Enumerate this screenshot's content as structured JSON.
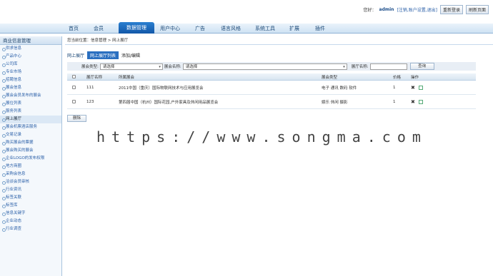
{
  "header": {
    "welcome": "您好：",
    "user": "admin",
    "links": "[注销,账户设置,退出]",
    "btn_home": "重新登录",
    "btn_refresh": "刷新页面"
  },
  "nav": {
    "items": [
      "首页",
      "会员",
      "",
      "用户中心",
      "广告",
      "语言风格",
      "系统工具",
      "扩展",
      "插件"
    ],
    "active": "数据管理"
  },
  "sidebar": {
    "title": "商业信息管理",
    "items": [
      "供求信息",
      "产品中心",
      "公司库",
      "专业市场",
      "招聘信息",
      "展会信息",
      "展会会员发布的展会",
      "展位列表",
      "服务列表",
      "网上展厅",
      "展会机票酒店服务",
      "交易记录",
      "购买展会的票据",
      "展会购买的展会",
      "企业LOGO的发布权限",
      "地方商圈",
      "采购会信息",
      "洽谈会员审核",
      "行业资讯",
      "标签关联",
      "标签库",
      "信息关键字",
      "企业动态",
      "行业调查"
    ],
    "current_index": 9
  },
  "main": {
    "breadcrumb": "您当前位置：信息管理 > 网上展厅",
    "tabs": [
      "网上展厅",
      "网上展厅列表",
      "添加/编辑"
    ],
    "filters": {
      "type_label": "展会类型:",
      "type_value": "请选择",
      "name_label": "展会名称:",
      "name_value": "请选择",
      "hall_label": "展厅名称:",
      "query": "查询"
    },
    "columns": [
      "展厅名称",
      "所属展会",
      "展会类型",
      "价格",
      "操作"
    ],
    "rows": [
      {
        "id": "111",
        "expo": "2011中国（重庆）国际物联网技术与应用展览会",
        "type": "电子 通讯 数码 软件",
        "price": "1"
      },
      {
        "id": "123",
        "expo": "第四届中国（杭州）国际花园,户外家具及休闲用品展览会",
        "type": "娱乐 休闲 摄影",
        "price": "1"
      }
    ],
    "delete": "删除"
  },
  "watermark": "https://www.songma.com",
  "colors": {
    "accent": "#1257a8",
    "sidebar_bg": "#f4f8fc",
    "nav_bg": "#cfe2f3"
  }
}
